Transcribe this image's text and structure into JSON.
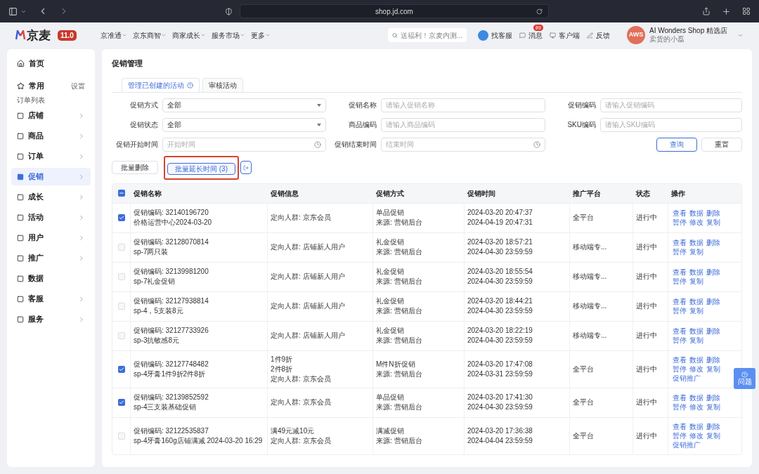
{
  "browser": {
    "url": "shop.jd.com"
  },
  "header": {
    "logo": "京麦",
    "version": "11.0",
    "nav": [
      "京准通",
      "京东商智",
      "商家成长",
      "服务市场",
      "更多"
    ],
    "search_placeholder": "送福利！京麦内测...",
    "tools": [
      {
        "kind": "service",
        "label": "找客服"
      },
      {
        "kind": "message",
        "label": "消息",
        "badge": "89"
      },
      {
        "kind": "client",
        "label": "客户端"
      },
      {
        "kind": "feedback",
        "label": "反馈"
      }
    ],
    "shop": {
      "avatar": "AWS",
      "name": "AI Wonders Shop 精选店",
      "subtitle": "卖货的小磊"
    }
  },
  "sidebar": {
    "items": [
      {
        "kind": "home",
        "label": "首页",
        "selected": false
      },
      {
        "kind": "section",
        "label": "常用",
        "action": "设置",
        "selected": false
      },
      {
        "kind": "shortcut",
        "label": "订单列表",
        "selected": false
      },
      {
        "kind": "menu",
        "label": "店铺",
        "arrow": true,
        "selected": false
      },
      {
        "kind": "menu",
        "label": "商品",
        "arrow": true,
        "selected": false
      },
      {
        "kind": "menu",
        "label": "订单",
        "arrow": true,
        "selected": false
      },
      {
        "kind": "menu",
        "label": "促销",
        "arrow": true,
        "selected": true
      },
      {
        "kind": "menu",
        "label": "成长",
        "arrow": true,
        "selected": false
      },
      {
        "kind": "menu",
        "label": "活动",
        "arrow": true,
        "selected": false
      },
      {
        "kind": "menu",
        "label": "用户",
        "arrow": true,
        "selected": false
      },
      {
        "kind": "menu",
        "label": "推广",
        "arrow": true,
        "selected": false
      },
      {
        "kind": "menu",
        "label": "数据",
        "arrow": false,
        "selected": false
      },
      {
        "kind": "menu",
        "label": "客服",
        "arrow": true,
        "selected": false
      },
      {
        "kind": "menu",
        "label": "服务",
        "arrow": true,
        "selected": false
      }
    ]
  },
  "page": {
    "title": "促销管理",
    "tabs": [
      {
        "label": "管理已创建的活动",
        "help": true,
        "selected": true
      },
      {
        "label": "审核活动",
        "help": false,
        "selected": false
      }
    ],
    "filters": [
      {
        "kind": "select",
        "label": "促销方式",
        "value": "全部"
      },
      {
        "kind": "input",
        "label": "促销名称",
        "placeholder": "请输入促销名称"
      },
      {
        "kind": "input",
        "label": "促销编码",
        "placeholder": "请输入促销编码"
      },
      {
        "kind": "select",
        "label": "促销状态",
        "value": "全部"
      },
      {
        "kind": "input",
        "label": "商品编码",
        "placeholder": "请输入商品编码"
      },
      {
        "kind": "input",
        "label": "SKU编码",
        "placeholder": "请输入SKU编码"
      },
      {
        "kind": "date",
        "label": "促销开始时间",
        "placeholder": "开始时间"
      },
      {
        "kind": "date",
        "label": "促销结束时间",
        "placeholder": "结束时间"
      }
    ],
    "filter_buttons": [
      {
        "label": "查询",
        "primary": true
      },
      {
        "label": "重置",
        "primary": false
      }
    ],
    "bulk_actions": [
      {
        "label": "批量删除",
        "highlighted": false
      },
      {
        "label": "批量延长时间 (3)",
        "highlighted": true
      }
    ],
    "table": {
      "columns": [
        "促销名称",
        "促销信息",
        "促销方式",
        "促销时间",
        "推广平台",
        "状态",
        "操作"
      ],
      "select_all_partial": true,
      "rows": [
        {
          "checked": true,
          "name": [
            "促销编码: 32140196720",
            "价格运营中心2024-03-20"
          ],
          "info": [
            "定向人群: 京东会员"
          ],
          "method": [
            "单品促销",
            "来源: 营销后台"
          ],
          "time": [
            "2024-03-20 20:47:37",
            "2024-04-19 20:47:31"
          ],
          "platform": "全平台",
          "status": "进行中",
          "actions": [
            "查看",
            "数据",
            "删除",
            "暂停",
            "修改",
            "复制"
          ]
        },
        {
          "checked": false,
          "name": [
            "促销编码: 32128070814",
            "sp-7两只装"
          ],
          "info": [
            "定向人群: 店铺新人用户"
          ],
          "method": [
            "礼金促销",
            "来源: 营销后台"
          ],
          "time": [
            "2024-03-20 18:57:21",
            "2024-04-30 23:59:59"
          ],
          "platform": "移动端专...",
          "status": "进行中",
          "actions": [
            "查看",
            "数据",
            "删除",
            "暂停",
            "复制"
          ]
        },
        {
          "checked": false,
          "name": [
            "促销编码: 32139981200",
            "sp-7礼金促销"
          ],
          "info": [
            "定向人群: 店铺新人用户"
          ],
          "method": [
            "礼金促销",
            "来源: 营销后台"
          ],
          "time": [
            "2024-03-20 18:55:54",
            "2024-04-30 23:59:59"
          ],
          "platform": "移动端专...",
          "status": "进行中",
          "actions": [
            "查看",
            "数据",
            "删除",
            "暂停",
            "复制"
          ]
        },
        {
          "checked": false,
          "name": [
            "促销编码: 32127938814",
            "sp-4，5支装8元"
          ],
          "info": [
            "定向人群: 店铺新人用户"
          ],
          "method": [
            "礼金促销",
            "来源: 营销后台"
          ],
          "time": [
            "2024-03-20 18:44:21",
            "2024-04-30 23:59:59"
          ],
          "platform": "移动端专...",
          "status": "进行中",
          "actions": [
            "查看",
            "数据",
            "删除",
            "暂停",
            "复制"
          ]
        },
        {
          "checked": false,
          "name": [
            "促销编码: 32127733926",
            "sp-3抗敏感8元"
          ],
          "info": [
            "定向人群: 店铺新人用户"
          ],
          "method": [
            "礼金促销",
            "来源: 营销后台"
          ],
          "time": [
            "2024-03-20 18:22:19",
            "2024-04-30 23:59:59"
          ],
          "platform": "移动端专...",
          "status": "进行中",
          "actions": [
            "查看",
            "数据",
            "删除",
            "暂停",
            "复制"
          ]
        },
        {
          "checked": true,
          "name": [
            "促销编码: 32127748482",
            "sp-4牙膏1件9折2件8折"
          ],
          "info": [
            "1件9折",
            "2件8折",
            "定向人群: 京东会员"
          ],
          "method": [
            "M件N折促销",
            "来源: 营销后台"
          ],
          "time": [
            "2024-03-20 17:47:08",
            "2024-03-31 23:59:59"
          ],
          "platform": "全平台",
          "status": "进行中",
          "actions": [
            "查看",
            "数据",
            "删除",
            "暂停",
            "修改",
            "复制",
            "促销推广"
          ]
        },
        {
          "checked": true,
          "name": [
            "促销编码: 32139852592",
            "sp-4三支装基础促销"
          ],
          "info": [
            "定向人群: 京东会员"
          ],
          "method": [
            "单品促销",
            "来源: 营销后台"
          ],
          "time": [
            "2024-03-20 17:41:30",
            "2024-04-30 23:59:59"
          ],
          "platform": "全平台",
          "status": "进行中",
          "actions": [
            "查看",
            "数据",
            "删除",
            "暂停",
            "修改",
            "复制"
          ]
        },
        {
          "checked": false,
          "name": [
            "促销编码: 32122535837",
            "sp-4牙膏160g店铺满减 2024-03-20 16:29"
          ],
          "info": [
            "满49元减10元",
            "定向人群: 京东会员"
          ],
          "method": [
            "满减促销",
            "来源: 营销后台"
          ],
          "time": [
            "2024-03-20 17:36:38",
            "2024-04-04 23:59:59"
          ],
          "platform": "全平台",
          "status": "进行中",
          "actions": [
            "查看",
            "数据",
            "删除",
            "暂停",
            "修改",
            "复制",
            "促销推广"
          ]
        }
      ]
    }
  },
  "float_button": {
    "label": "问题"
  }
}
